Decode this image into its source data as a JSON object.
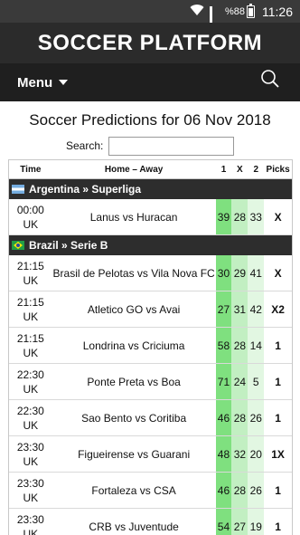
{
  "status_bar": {
    "battery": "%88",
    "time": "11:26"
  },
  "brand": {
    "title": "SOCCER PLATFORM"
  },
  "nav": {
    "menu_label": "Menu"
  },
  "page": {
    "title": "Soccer Predictions for 06 Nov 2018"
  },
  "search": {
    "label": "Search:",
    "value": ""
  },
  "table": {
    "headers": {
      "time": "Time",
      "match": "Home – Away",
      "one": "1",
      "x": "X",
      "two": "2",
      "picks": "Picks"
    },
    "leagues": [
      {
        "name": "Argentina » Superliga",
        "flag": "argentina-flag-icon",
        "matches": [
          {
            "time": "00:00",
            "tz": "UK",
            "teams": "Lanus vs Huracan",
            "p1": "39",
            "px": "28",
            "p2": "33",
            "pick": "X"
          }
        ]
      },
      {
        "name": "Brazil » Serie B",
        "flag": "brazil-flag-icon",
        "matches": [
          {
            "time": "21:15",
            "tz": "UK",
            "teams": "Brasil de Pelotas vs Vila Nova FC",
            "p1": "30",
            "px": "29",
            "p2": "41",
            "pick": "X"
          },
          {
            "time": "21:15",
            "tz": "UK",
            "teams": "Atletico GO vs Avai",
            "p1": "27",
            "px": "31",
            "p2": "42",
            "pick": "X2"
          },
          {
            "time": "21:15",
            "tz": "UK",
            "teams": "Londrina vs Criciuma",
            "p1": "58",
            "px": "28",
            "p2": "14",
            "pick": "1"
          },
          {
            "time": "22:30",
            "tz": "UK",
            "teams": "Ponte Preta vs Boa",
            "p1": "71",
            "px": "24",
            "p2": "5",
            "pick": "1"
          },
          {
            "time": "22:30",
            "tz": "UK",
            "teams": "Sao Bento vs Coritiba",
            "p1": "46",
            "px": "28",
            "p2": "26",
            "pick": "1"
          },
          {
            "time": "23:30",
            "tz": "UK",
            "teams": "Figueirense vs Guarani",
            "p1": "48",
            "px": "32",
            "p2": "20",
            "pick": "1X"
          },
          {
            "time": "23:30",
            "tz": "UK",
            "teams": "Fortaleza vs CSA",
            "p1": "46",
            "px": "28",
            "p2": "26",
            "pick": "1"
          },
          {
            "time": "23:30",
            "tz": "UK",
            "teams": "CRB vs Juventude",
            "p1": "54",
            "px": "27",
            "p2": "19",
            "pick": "1"
          }
        ]
      }
    ]
  },
  "colors": {
    "brand_bg": "#2b2b2b",
    "nav_bg": "#1f1f1f",
    "league_bg": "#2d2d2d",
    "prob_high": "#7fe07f",
    "prob_mid": "#c2efc2",
    "prob_low": "#e2f7e2"
  }
}
